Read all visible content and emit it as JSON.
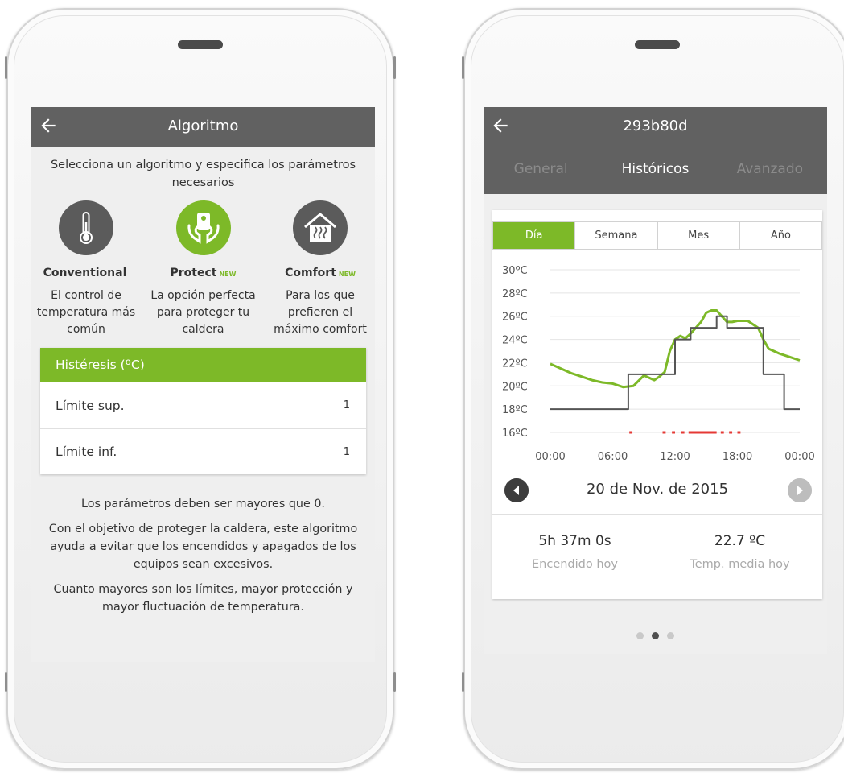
{
  "left_screen": {
    "title": "Algoritmo",
    "intro": "Selecciona un algoritmo y especifica los parámetros necesarios",
    "algorithms": [
      {
        "name": "Conventional",
        "badge": "",
        "description": "El control de temperatura más común",
        "icon": "thermometer-icon",
        "selected": false
      },
      {
        "name": "Protect",
        "badge": "NEW",
        "description": "La opción perfecta para proteger tu caldera",
        "icon": "protect-device-icon",
        "selected": true
      },
      {
        "name": "Comfort",
        "badge": "NEW",
        "description": "Para los que prefieren el máximo comfort",
        "icon": "house-heat-icon",
        "selected": false
      }
    ],
    "hysteresis": {
      "header": "Histéresis (ºC)",
      "upper_label": "Límite sup.",
      "upper_value": "1",
      "lower_label": "Límite inf.",
      "lower_value": "1"
    },
    "notes": [
      "Los parámetros deben ser mayores que 0.",
      "Con el objetivo de proteger la caldera, este algoritmo ayuda a evitar que los encendidos y apagados de los equipos sean excesivos.",
      "Cuanto mayores son los límites, mayor protección y mayor fluctuación de temperatura."
    ]
  },
  "right_screen": {
    "title": "293b80d",
    "tabs": [
      "General",
      "Históricos",
      "Avanzado"
    ],
    "active_tab": 1,
    "periods": [
      "Día",
      "Semana",
      "Mes",
      "Año"
    ],
    "active_period": 0,
    "date": "20 de Nov. de 2015",
    "stats": [
      {
        "value": "5h 37m 0s",
        "label": "Encendido hoy"
      },
      {
        "value": "22.7 ºC",
        "label": "Temp. media hoy"
      }
    ],
    "page_dots": 3,
    "active_dot": 1
  },
  "colors": {
    "accent_green": "#7db928",
    "appbar_gray": "#616161",
    "setpoint_line": "#555555",
    "heating_on": "#e53935"
  },
  "chart_data": {
    "type": "line",
    "title": "",
    "xlabel": "",
    "ylabel": "",
    "x_ticks": [
      "00:00",
      "06:00",
      "12:00",
      "18:00",
      "00:00"
    ],
    "y_ticks": [
      "30ºC",
      "28ºC",
      "26ºC",
      "24ºC",
      "22ºC",
      "20ºC",
      "18ºC",
      "16ºC"
    ],
    "xlim": [
      0,
      24
    ],
    "ylim": [
      16,
      30
    ],
    "grid": true,
    "series": [
      {
        "kind": "measured",
        "color": "#7db928",
        "x": [
          0,
          1,
          2,
          3,
          4,
          5,
          6,
          7,
          8,
          9,
          10,
          10.5,
          11,
          11.5,
          12,
          12.5,
          13,
          13.5,
          14,
          14.5,
          15,
          15.5,
          16,
          16.5,
          17,
          17.5,
          18,
          19,
          20,
          20.5,
          21,
          22,
          23,
          24
        ],
        "y": [
          21.9,
          21.5,
          21.1,
          20.8,
          20.5,
          20.3,
          20.2,
          19.9,
          20.0,
          20.9,
          20.5,
          20.8,
          21.2,
          23.0,
          24.0,
          24.3,
          24.1,
          24.5,
          25.0,
          25.5,
          26.3,
          26.5,
          26.5,
          26.0,
          25.5,
          25.5,
          25.6,
          25.6,
          25.0,
          24.0,
          23.2,
          22.8,
          22.5,
          22.2
        ]
      },
      {
        "kind": "setpoint",
        "color": "#555555",
        "x": [
          0,
          7.5,
          7.5,
          10.5,
          10.5,
          12,
          12,
          13.5,
          13.5,
          16,
          16,
          17,
          17,
          20.5,
          20.5,
          22.5,
          22.5,
          24
        ],
        "y": [
          18,
          18,
          21,
          21,
          21,
          21,
          24,
          24,
          25,
          25,
          26,
          26,
          25,
          25,
          21,
          21,
          18,
          18
        ]
      }
    ],
    "heating_on_segments": [
      [
        7.6,
        7.9
      ],
      [
        10.8,
        11.1
      ],
      [
        11.7,
        12.0
      ],
      [
        12.6,
        12.9
      ],
      [
        13.3,
        16.0
      ],
      [
        16.4,
        16.7
      ],
      [
        17.2,
        17.5
      ],
      [
        18.0,
        18.3
      ]
    ]
  }
}
